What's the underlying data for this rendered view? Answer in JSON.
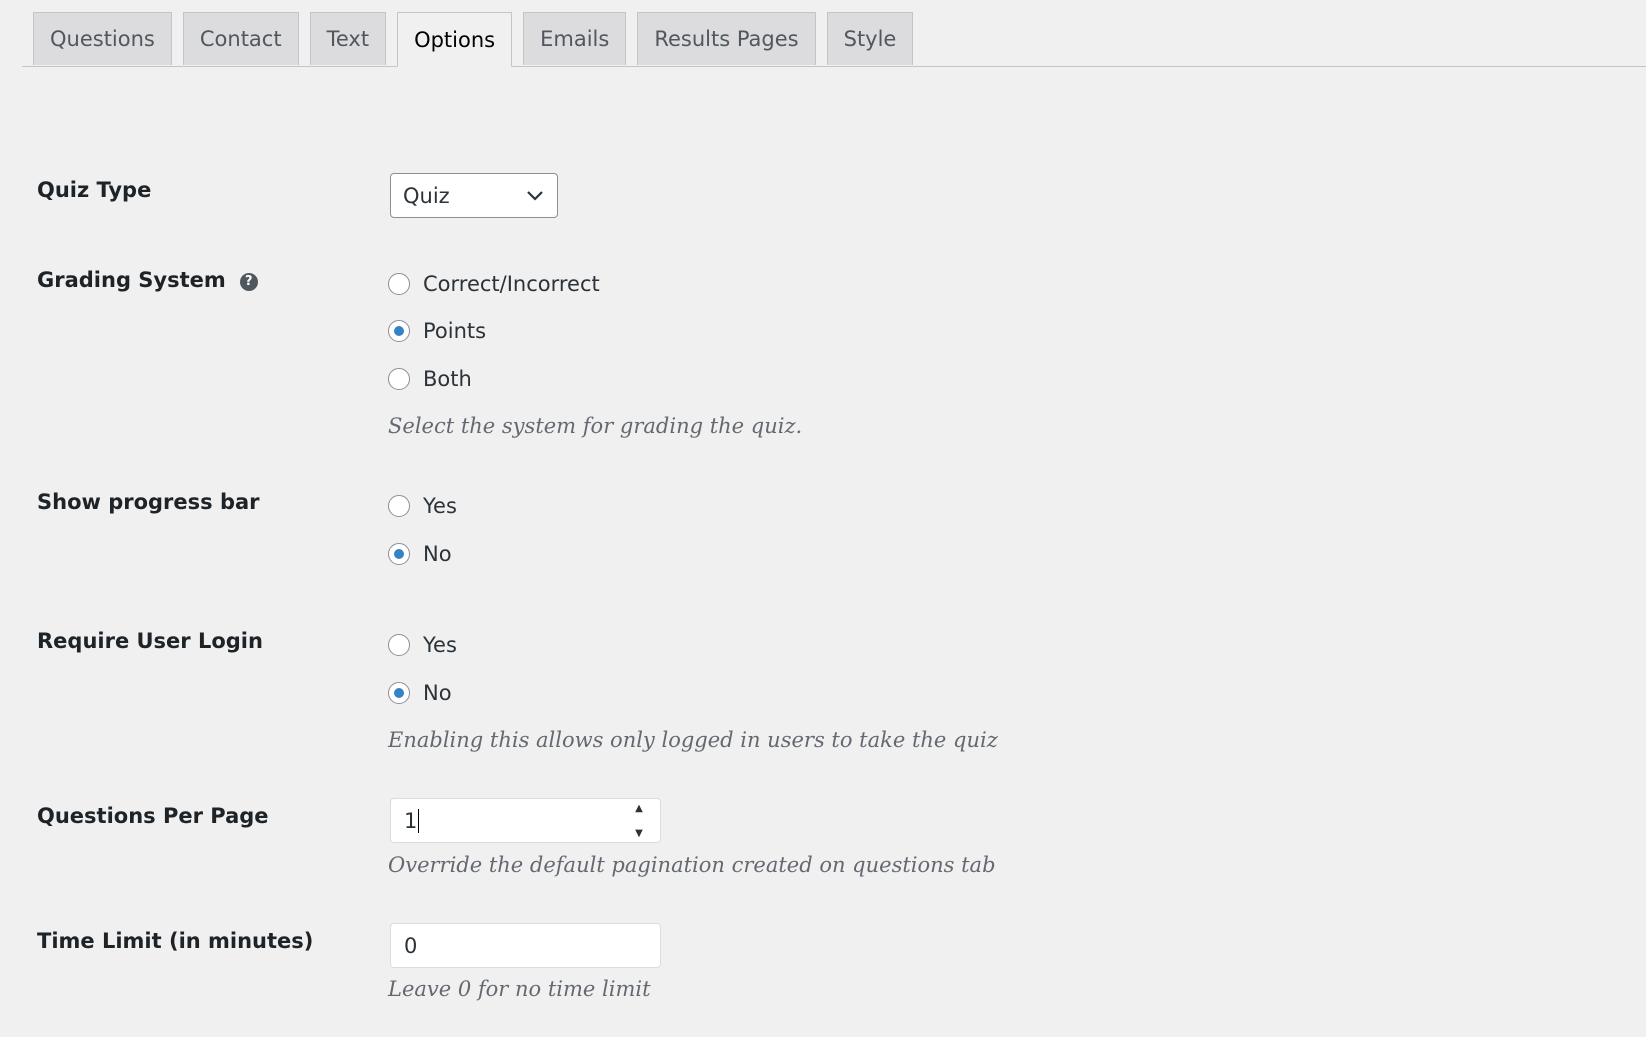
{
  "tabs": [
    {
      "label": "Questions"
    },
    {
      "label": "Contact"
    },
    {
      "label": "Text"
    },
    {
      "label": "Options"
    },
    {
      "label": "Emails"
    },
    {
      "label": "Results Pages"
    },
    {
      "label": "Style"
    }
  ],
  "active_tab": "Options",
  "quiz_type": {
    "label": "Quiz Type",
    "selected": "Quiz"
  },
  "grading_system": {
    "label": "Grading System",
    "help_icon": "?",
    "options": [
      "Correct/Incorrect",
      "Points",
      "Both"
    ],
    "selected": "Points",
    "description": "Select the system for grading the quiz."
  },
  "progress_bar": {
    "label": "Show progress bar",
    "options": [
      "Yes",
      "No"
    ],
    "selected": "No"
  },
  "require_login": {
    "label": "Require User Login",
    "options": [
      "Yes",
      "No"
    ],
    "selected": "No",
    "description": "Enabling this allows only logged in users to take the quiz"
  },
  "questions_per_page": {
    "label": "Questions Per Page",
    "value": "1",
    "description": "Override the default pagination created on questions tab"
  },
  "time_limit": {
    "label": "Time Limit (in minutes)",
    "value": "0",
    "description": "Leave 0 for no time limit"
  }
}
